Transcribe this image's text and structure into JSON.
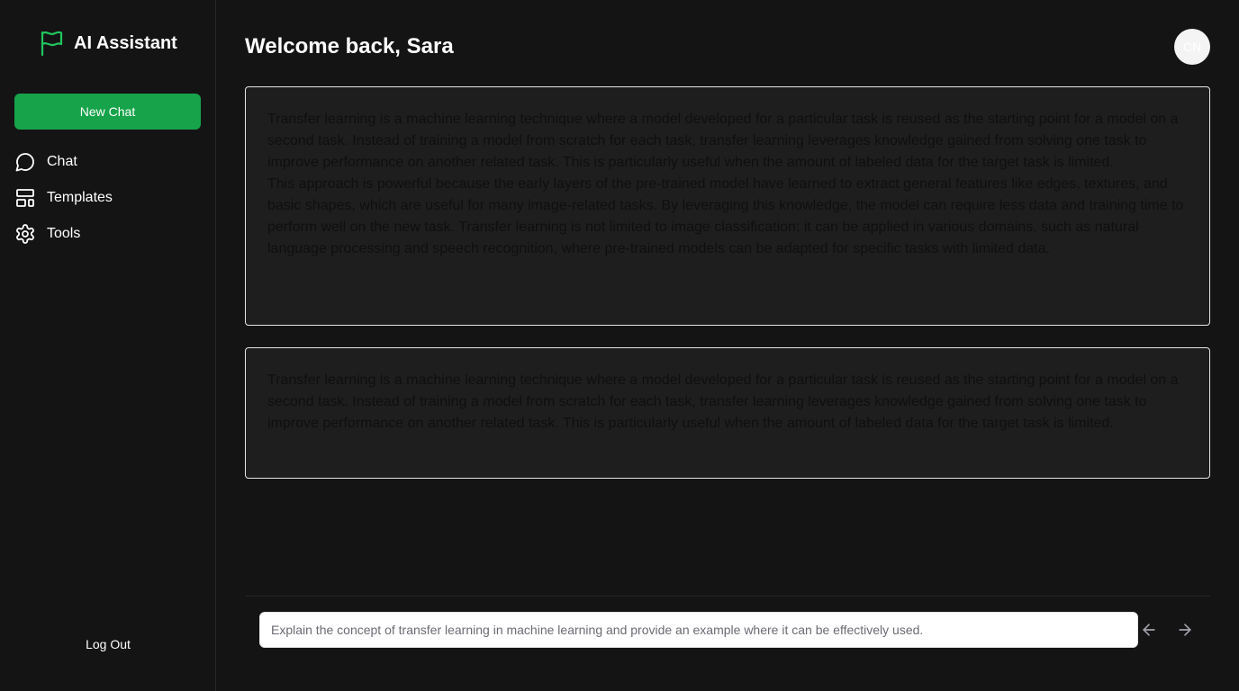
{
  "app": {
    "title": "AI Assistant",
    "accent": "#16a34a"
  },
  "sidebar": {
    "new_chat_label": "New Chat",
    "items": [
      {
        "label": "Chat",
        "icon": "chat-bubble-icon"
      },
      {
        "label": "Templates",
        "icon": "layout-template-icon"
      },
      {
        "label": "Tools",
        "icon": "gear-icon"
      }
    ],
    "logout_label": "Log Out"
  },
  "header": {
    "welcome": "Welcome back, Sara",
    "avatar_initials": "CN"
  },
  "responses": [
    {
      "paragraphs": [
        "Transfer learning is a machine learning technique where a model developed for a particular task is reused as the starting point for a model on a second task. Instead of training a model from scratch for each task, transfer learning leverages knowledge gained from solving one task to improve performance on another related task. This is particularly useful when the amount of labeled data for the target task is limited.",
        "This approach is powerful because the early layers of the pre-trained model have learned to extract general features like edges, textures, and basic shapes, which are useful for many image-related tasks. By leveraging this knowledge, the model can require less data and training time to perform well on the new task. Transfer learning is not limited to image classification; it can be applied in various domains, such as natural language processing and speech recognition, where pre-trained models can be adapted for specific tasks with limited data."
      ]
    },
    {
      "paragraphs": [
        "Transfer learning is a machine learning technique where a model developed for a particular task is reused as the starting point for a model on a second task. Instead of training a model from scratch for each task, transfer learning leverages knowledge gained from solving one task to improve performance on another related task. This is particularly useful when the amount of labeled data for the target task is limited."
      ]
    }
  ],
  "composer": {
    "value": "",
    "placeholder": "Explain the concept of transfer learning in machine learning and provide an example where it can be effectively used.",
    "prev_icon": "arrow-left-icon",
    "next_icon": "arrow-right-icon"
  }
}
